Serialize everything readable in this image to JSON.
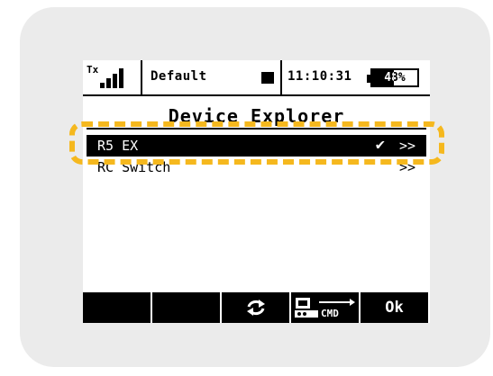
{
  "statusbar": {
    "tx_label": "Tx",
    "profile": "Default",
    "time": "11:10:31",
    "battery_percent": "48%",
    "battery_level": 0.48,
    "signal_bars": 4
  },
  "title": "Device Explorer",
  "devices": [
    {
      "label": "R5 EX",
      "check": "✔",
      "arrow": ">>",
      "selected": true
    },
    {
      "label": "RC Switch",
      "check": "",
      "arrow": ">>",
      "selected": false
    }
  ],
  "softkeys": [
    {
      "label": "",
      "icon": ""
    },
    {
      "label": "",
      "icon": ""
    },
    {
      "label": "⇄",
      "icon": "refresh-icon"
    },
    {
      "label": "CMD",
      "icon": "cmd-icon"
    },
    {
      "label": "Ok",
      "icon": ""
    }
  ],
  "colors": {
    "bezel": "#ebebeb",
    "screen_bg": "#ffffff",
    "highlight": "#f5b81e",
    "selection": "#000000"
  }
}
